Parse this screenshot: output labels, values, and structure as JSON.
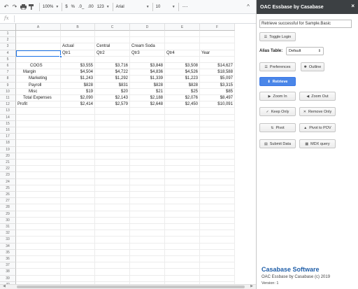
{
  "toolbar": {
    "icons": [
      "undo-icon",
      "redo-icon",
      "print-icon",
      "paint-format-icon"
    ],
    "zoom": "100%",
    "currency": "$",
    "percent": "%",
    "decrease_decimal": ".0_",
    "increase_decimal": ".00",
    "more_formats": "123",
    "font": "Arial",
    "font_size": "10",
    "collapse": "^"
  },
  "formula_bar": {
    "fx": "fx",
    "value": ""
  },
  "sheet": {
    "columns": [
      "A",
      "B",
      "C",
      "D",
      "E",
      "F"
    ],
    "rows": [
      "1",
      "2",
      "3",
      "4",
      "5",
      "6",
      "7",
      "8",
      "9",
      "10",
      "11",
      "12",
      "13",
      "14",
      "15",
      "16",
      "17",
      "18",
      "19",
      "20",
      "21",
      "22",
      "23",
      "24",
      "25",
      "26",
      "27",
      "28",
      "29",
      "30",
      "31",
      "32",
      "33",
      "34",
      "35",
      "36",
      "37",
      "38",
      "39",
      "40"
    ],
    "cells": {
      "r3": {
        "b": "Actual",
        "c": "Central",
        "d": "Cream Soda"
      },
      "r4": {
        "b": "Qtr1",
        "c": "Qtr2",
        "d": "Qtr3",
        "e": "Qtr4",
        "f": "Year"
      },
      "data_rows": [
        {
          "row": 6,
          "label": "COGS",
          "values": [
            "$3,555",
            "$3,716",
            "$3,848",
            "$3,508",
            "$14,627"
          ]
        },
        {
          "row": 7,
          "label": "Margin",
          "values": [
            "$4,504",
            "$4,722",
            "$4,836",
            "$4,526",
            "$18,588"
          ]
        },
        {
          "row": 8,
          "label": "Marketing",
          "values": [
            "$1,243",
            "$1,292",
            "$1,339",
            "$1,223",
            "$5,097"
          ]
        },
        {
          "row": 9,
          "label": "Payroll",
          "values": [
            "$828",
            "$831",
            "$828",
            "$828",
            "$3,315"
          ]
        },
        {
          "row": 10,
          "label": "Misc",
          "values": [
            "$19",
            "$20",
            "$21",
            "$25",
            "$85"
          ]
        },
        {
          "row": 11,
          "label": "Total Expenses",
          "values": [
            "$2,090",
            "$2,143",
            "$2,188",
            "$2,076",
            "$8,497"
          ]
        },
        {
          "row": 12,
          "label": "Profit",
          "values": [
            "$2,414",
            "$2,579",
            "$2,648",
            "$2,450",
            "$10,091"
          ]
        }
      ]
    },
    "selected_cell": "A4"
  },
  "panel": {
    "title": "OAC Essbase by Casabase",
    "close": "×",
    "status": "Retrieve successful for Sample.Basic",
    "toggle_login": "Toggle Login",
    "alias_label": "Alias Table:",
    "alias_value": "Default",
    "preferences": "Preferences",
    "outline": "Outline",
    "retrieve": "Retrieve",
    "zoom_in": "Zoom In",
    "zoom_out": "Zoom Out",
    "keep_only": "Keep Only",
    "remove_only": "Remove Only",
    "pivot": "Pivot",
    "pivot_to_pov": "Pivot to POV",
    "submit_data": "Submit Data",
    "mdx_query": "MDX query",
    "footer_title": "Casabase Software",
    "footer_copyright": "OAC Essbase by Casabase (c) 2019",
    "version": "Version: 1"
  },
  "colors": {
    "accent": "#4a86e8",
    "brand": "#1f5ea8",
    "panel_header": "#3c4043",
    "selection": "#1a73e8"
  }
}
